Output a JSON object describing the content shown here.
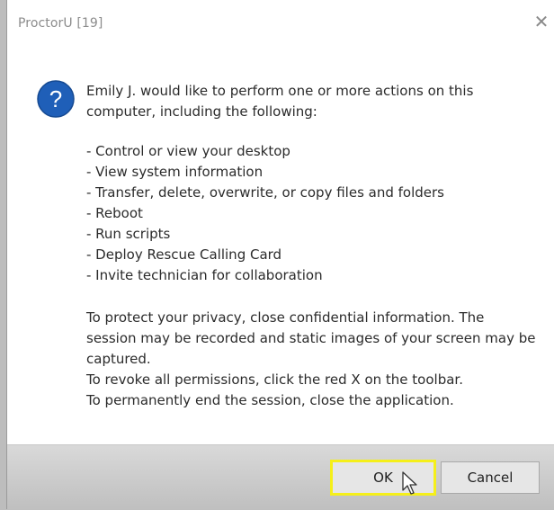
{
  "window": {
    "title": "ProctorU [19]",
    "close_glyph": "✕"
  },
  "message": {
    "intro": "Emily J. would like to perform one or more actions on this computer, including the following:",
    "actions": [
      "- Control or view your desktop",
      "- View system information",
      "- Transfer, delete, overwrite, or copy files and folders",
      "- Reboot",
      "- Run scripts",
      "- Deploy Rescue Calling Card",
      "- Invite technician for collaboration"
    ],
    "privacy": "To protect your privacy, close confidential information. The session may be recorded and static images of your screen may be captured.",
    "revoke": "To revoke all permissions, click the red X on the toolbar.",
    "end": "To permanently end the session, close the application."
  },
  "buttons": {
    "ok": "OK",
    "cancel": "Cancel"
  },
  "icons": {
    "question": "question-icon",
    "cursor": "mouse-cursor-icon"
  },
  "colors": {
    "question_blue": "#1f5fb8",
    "highlight": "#f5ef1a"
  }
}
